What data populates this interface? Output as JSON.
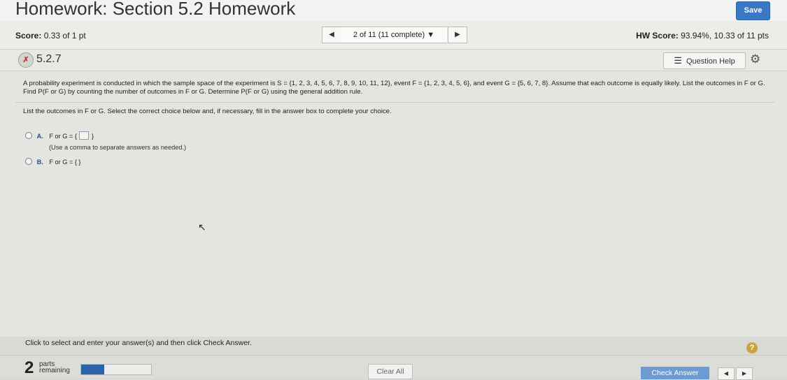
{
  "header": {
    "title": "Homework: Section 5.2 Homework",
    "save_label": "Save"
  },
  "scorebar": {
    "score_label": "Score:",
    "score_value": "0.33 of 1 pt",
    "prev_icon": "◀",
    "question_select": "2 of 11 (11 complete) ▼",
    "next_icon": "▶",
    "hw_score_label": "HW Score:",
    "hw_score_value": "93.94%, 10.33 of 11 pts"
  },
  "question": {
    "status_icon": "partial-credit-icon",
    "status_icon_glyph": "✗",
    "number": "5.2.7",
    "help_icon": "☰",
    "help_label": "Question Help",
    "gear_icon": "⚙",
    "prompt": "A probability experiment is conducted in which the sample space of the experiment is S = {1, 2, 3, 4, 5, 6, 7, 8, 9, 10, 11, 12}, event F = {1, 2, 3, 4, 5, 6}, and event G = {5, 6, 7, 8}. Assume that each outcome is equally likely. List the outcomes in F or G. Find P(F or G) by counting the number of outcomes in F or G. Determine P(F or G) using the general addition rule.",
    "instruction": "List the outcomes in F or G. Select the correct choice below and, if necessary, fill in the answer box to complete your choice.",
    "choice_a": {
      "letter": "A.",
      "text": "F or G = {",
      "close": "}"
    },
    "choice_a_hint": "(Use a comma to separate answers as needed.)",
    "choice_b": {
      "letter": "B.",
      "text": "F or G = { }"
    }
  },
  "bottom": {
    "instruction": "Click to select and enter your answer(s) and then click Check Answer.",
    "help_icon": "?"
  },
  "footer": {
    "parts_count": "2",
    "parts_label_1": "parts",
    "parts_label_2": "remaining",
    "progress_fraction": 0.33,
    "clear_label": "Clear All",
    "check_label": "Check Answer",
    "prev_icon": "◀",
    "next_icon": "▶"
  }
}
